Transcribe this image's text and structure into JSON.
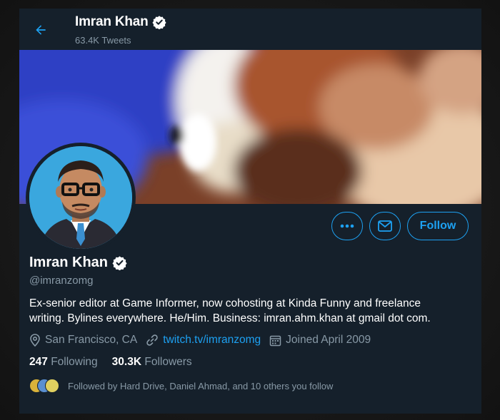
{
  "header": {
    "back_label": "Back",
    "name": "Imran Khan",
    "tweets": "63.4K Tweets"
  },
  "profile": {
    "name": "Imran Khan",
    "handle": "@imranzomg",
    "bio_line1": "Ex-senior editor at Game Informer, now cohosting at Kinda Funny and freelance",
    "bio_line2": "writing. Bylines everywhere. He/Him. Business: imran.ahm.khan at gmail dot com.",
    "location": "San Francisco, CA",
    "website": "twitch.tv/imranzomg",
    "joined": "Joined April 2009",
    "following_count": "247",
    "following_label": "Following",
    "followers_count": "30.3K",
    "followers_label": "Followers",
    "followed_by": "Followed by Hard Drive, Daniel Ahmad, and 10 others you follow"
  },
  "actions": {
    "follow_label": "Follow"
  },
  "colors": {
    "accent": "#1da1f2",
    "background": "#15202b",
    "secondary_text": "#8899a6"
  },
  "icons": {
    "back": "arrow-left-icon",
    "verified": "verified-badge-icon",
    "more": "more-dots-icon",
    "mail": "envelope-icon",
    "location": "location-pin-icon",
    "link": "link-icon",
    "calendar": "calendar-icon"
  }
}
